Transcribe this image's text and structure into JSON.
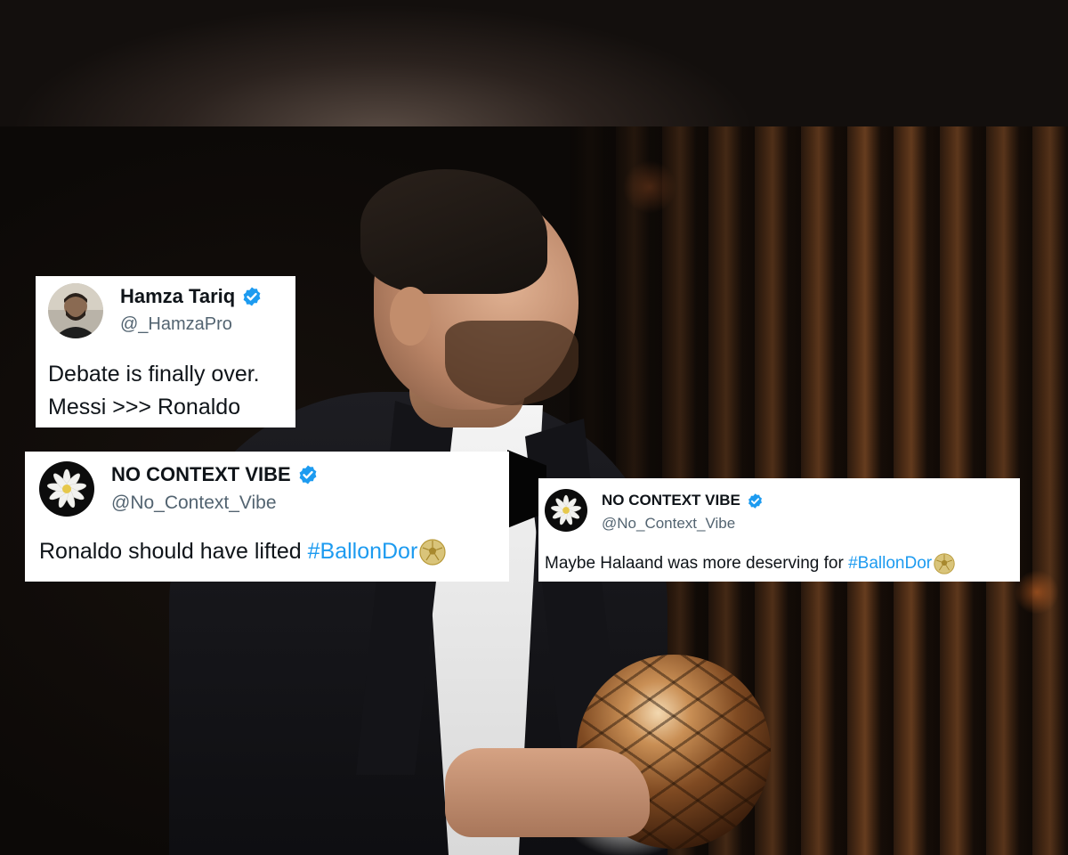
{
  "tweets": [
    {
      "display_name": "Hamza Tariq",
      "handle": "@_HamzaPro",
      "verified": true,
      "text_lines": [
        "Debate is finally over.",
        "Messi >>> Ronaldo"
      ],
      "avatar_icon": "profile-photo-avatar"
    },
    {
      "display_name": "NO CONTEXT VIBE",
      "handle": "@No_Context_Vibe",
      "verified": true,
      "text": "Ronaldo should have lifted ",
      "hashtag": "#BallonDor",
      "emoji_icon": "soccer-ball-icon",
      "avatar_icon": "white-flower-avatar"
    },
    {
      "display_name": "NO CONTEXT VIBE",
      "handle": "@No_Context_Vibe",
      "verified": true,
      "text": "Maybe Halaand was more deserving for ",
      "hashtag": "#BallonDor",
      "emoji_icon": "soccer-ball-icon",
      "avatar_icon": "white-flower-avatar"
    }
  ],
  "colors": {
    "verified_badge": "#1d9bf0",
    "hashtag": "#1d9bf0",
    "handle_text": "#536471",
    "card_background": "#ffffff"
  },
  "background": {
    "scene": "man in black tuxedo holding golden Ballon d'Or trophy on dark stage with copper striped backdrop"
  }
}
